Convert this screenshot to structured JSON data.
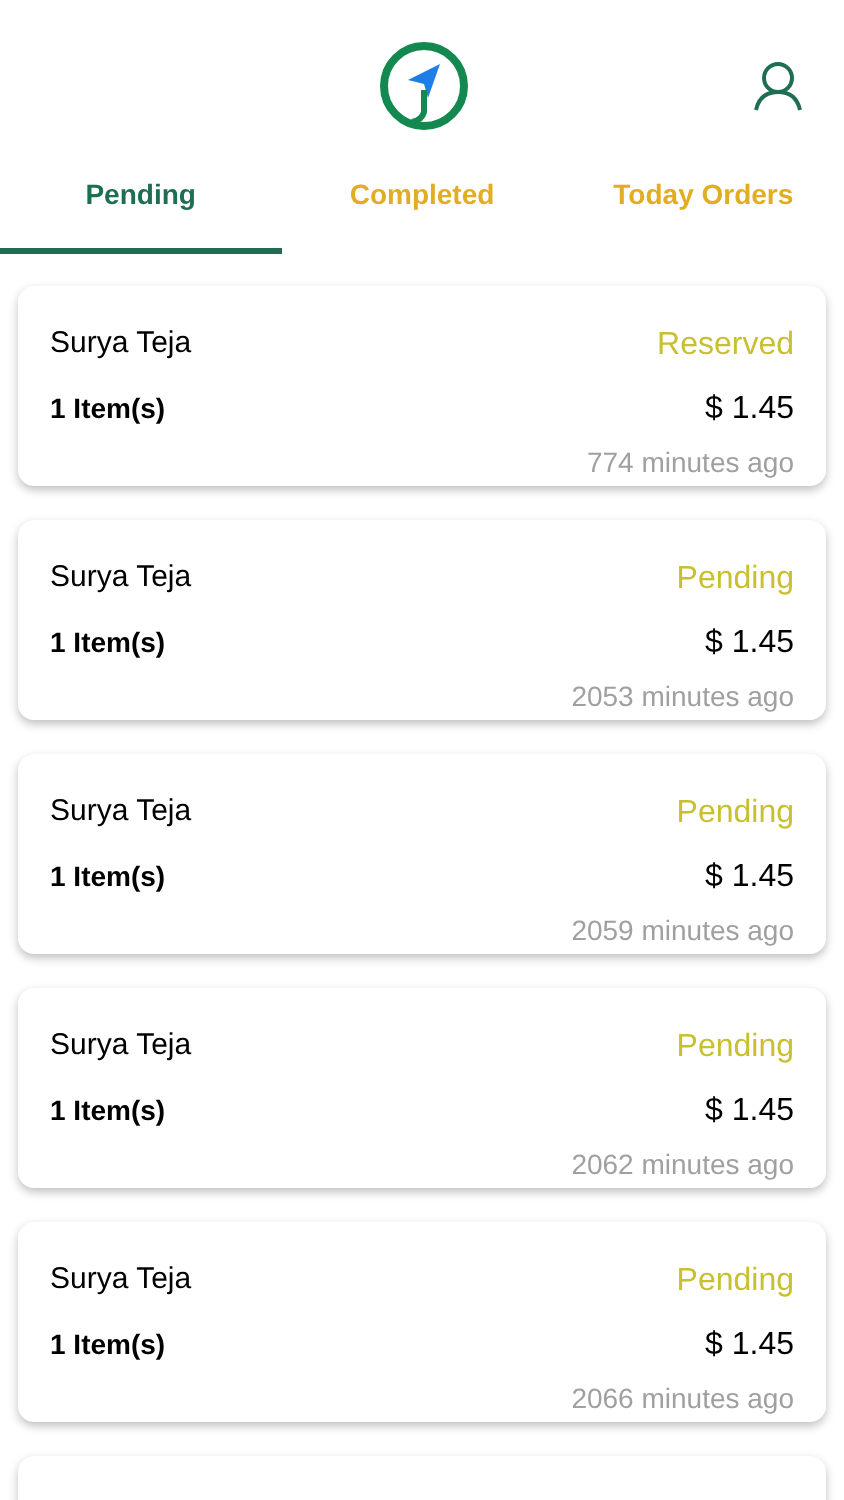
{
  "tabs": [
    {
      "label": "Pending",
      "selected": true
    },
    {
      "label": "Completed",
      "selected": false
    },
    {
      "label": "Today Orders",
      "selected": false
    }
  ],
  "orders": [
    {
      "customer": "Surya Teja",
      "items": "1 Item(s)",
      "status": "Reserved",
      "price": "$ 1.45",
      "time": "774 minutes ago"
    },
    {
      "customer": "Surya Teja",
      "items": "1 Item(s)",
      "status": "Pending",
      "price": "$ 1.45",
      "time": "2053 minutes ago"
    },
    {
      "customer": "Surya Teja",
      "items": "1 Item(s)",
      "status": "Pending",
      "price": "$ 1.45",
      "time": "2059 minutes ago"
    },
    {
      "customer": "Surya Teja",
      "items": "1 Item(s)",
      "status": "Pending",
      "price": "$ 1.45",
      "time": "2062 minutes ago"
    },
    {
      "customer": "Surya Teja",
      "items": "1 Item(s)",
      "status": "Pending",
      "price": "$ 1.45",
      "time": "2066 minutes ago"
    }
  ]
}
